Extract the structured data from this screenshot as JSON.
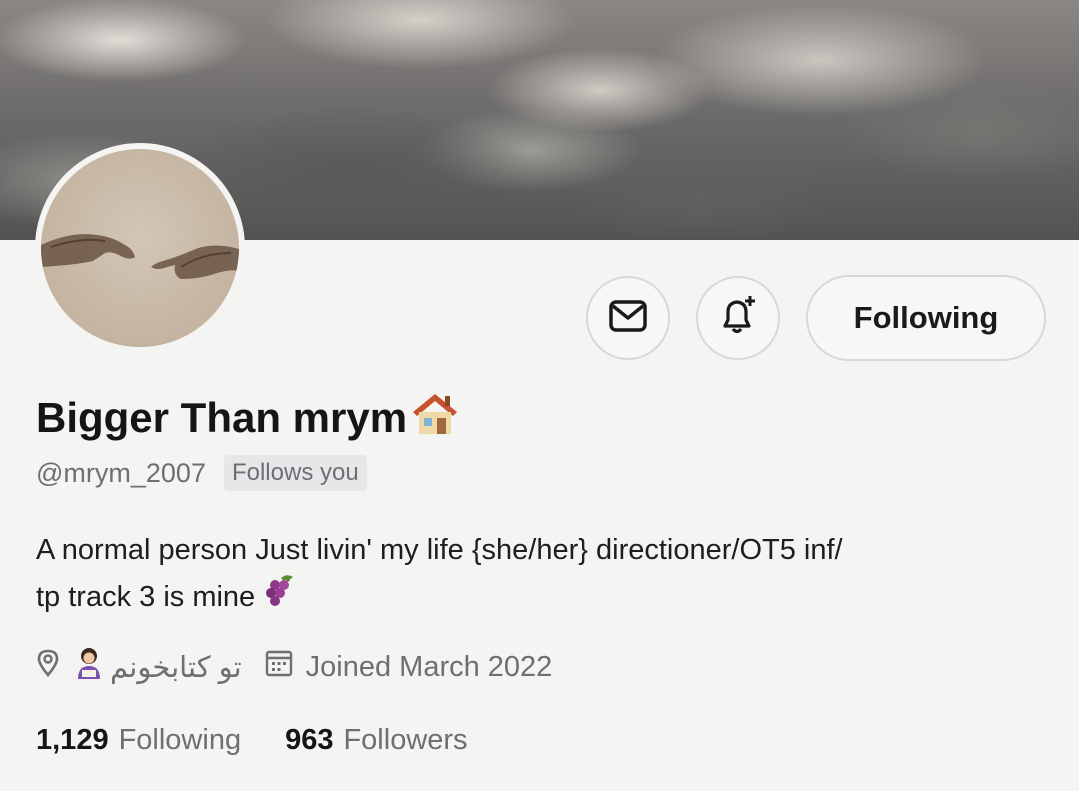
{
  "profile": {
    "display_name": "Bigger Than mrym",
    "name_emoji": "house-emoji",
    "handle": "@mrym_2007",
    "follows_you": "Follows you",
    "bio_line1": "A normal person  Just livin' my life   {she/her}  directioner/OT5  inf/",
    "bio_line2": "tp  track 3 is mine",
    "bio_emoji": "grapes-emoji",
    "location": "تو کتابخونم",
    "joined": "Joined March 2022",
    "following_count": "1,129",
    "following_label": "Following",
    "followers_count": "963",
    "followers_label": "Followers"
  },
  "actions": {
    "message_icon": "envelope-icon",
    "notify_icon": "bell-plus-icon",
    "follow_label": "Following"
  },
  "colors": {
    "text_primary": "#151515",
    "text_secondary": "#6d6f73",
    "background": "#f4f4f2",
    "border": "#d8d8d6"
  }
}
